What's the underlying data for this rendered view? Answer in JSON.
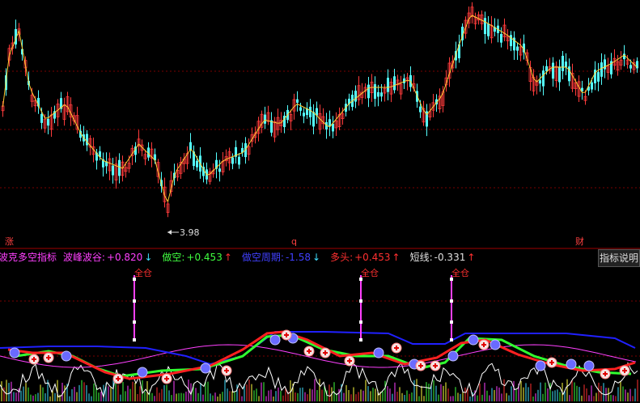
{
  "price_panel": {
    "low_label": "3.98",
    "markers": {
      "left": "涨",
      "mid": "q",
      "right": "财"
    }
  },
  "indicator": {
    "name": "波克多空指标",
    "items": [
      {
        "label": "波峰波谷:",
        "value": "+0.820",
        "arrow": "↓",
        "label_color": "#ff40ff",
        "value_color": "#ff40ff",
        "arrow_color": "#40e0ff"
      },
      {
        "label": "做空:",
        "value": "+0.453",
        "arrow": "↑",
        "label_color": "#40ff40",
        "value_color": "#40ff40",
        "arrow_color": "#ff3030"
      },
      {
        "label": "做空周期:",
        "value": "-1.58",
        "arrow": "↓",
        "label_color": "#4040ff",
        "value_color": "#4040ff",
        "arrow_color": "#40e0ff"
      },
      {
        "label": "多头:",
        "value": "+0.453",
        "arrow": "↑",
        "label_color": "#ff3030",
        "value_color": "#ff3030",
        "arrow_color": "#ff3030"
      },
      {
        "label": "短线:",
        "value": "-0.331",
        "arrow": "↑",
        "label_color": "#e0e0e0",
        "value_color": "#e0e0e0",
        "arrow_color": "#ff3030"
      }
    ],
    "help_button": "指标说明",
    "signal_label": "全仓"
  },
  "colors": {
    "up_candle": "#ff3b3b",
    "down_candle": "#54ffff",
    "ma_line": "#ffcc33",
    "grid": "#8b0000",
    "background": "#000000"
  }
}
